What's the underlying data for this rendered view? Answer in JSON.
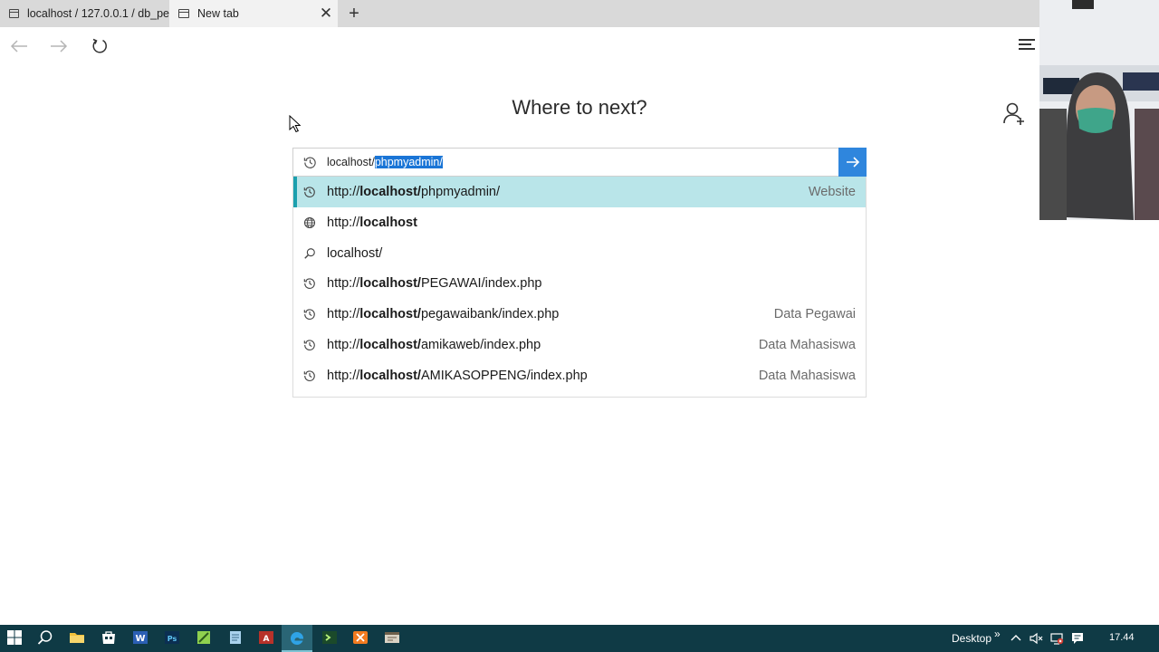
{
  "tabs": [
    {
      "label": "localhost / 127.0.0.1 / db_pe"
    },
    {
      "label": "New tab"
    }
  ],
  "heading": "Where to next?",
  "address": {
    "typed": "localhost/",
    "autocomplete": "phpmyadmin/"
  },
  "suggestions": [
    {
      "icon": "history-icon",
      "prefix": "http://",
      "bold": "localhost/",
      "rest": "phpmyadmin/",
      "tag": "Website",
      "active": true
    },
    {
      "icon": "globe-icon",
      "prefix": "http://",
      "bold": "localhost",
      "rest": "",
      "tag": "",
      "active": false
    },
    {
      "icon": "search-icon",
      "prefix": "",
      "bold": "",
      "rest": "localhost/",
      "tag": "",
      "active": false
    },
    {
      "icon": "history-icon",
      "prefix": "http://",
      "bold": "localhost/",
      "rest": "PEGAWAI/index.php",
      "tag": "",
      "active": false
    },
    {
      "icon": "history-icon",
      "prefix": "http://",
      "bold": "localhost/",
      "rest": "pegawaibank/index.php",
      "tag": "Data Pegawai",
      "active": false
    },
    {
      "icon": "history-icon",
      "prefix": "http://",
      "bold": "localhost/",
      "rest": "amikaweb/index.php",
      "tag": "Data Mahasiswa",
      "active": false
    },
    {
      "icon": "history-icon",
      "prefix": "http://",
      "bold": "localhost/",
      "rest": "AMIKASOPPENG/index.php",
      "tag": "Data Mahasiswa",
      "active": false
    }
  ],
  "taskbar": {
    "desktop_label": "Desktop",
    "chevron": "»",
    "clock": "17.44"
  },
  "colors": {
    "tabstrip": "#d9d9d9",
    "active_suggestion": "#b9e5e9",
    "go_button": "#2f86dd",
    "taskbar": "#0f3a45"
  }
}
